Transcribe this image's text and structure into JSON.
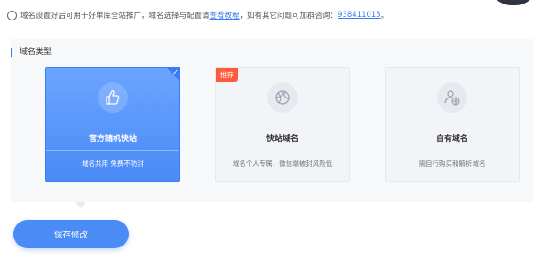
{
  "notice": {
    "icon": "info-icon",
    "text_before": "域名设置好后可用于好单库全站推广，域名选择与配置请",
    "link_text": "查看教程",
    "text_middle": "，如有其它问题可加群咨询：",
    "group_number": "938411015",
    "text_after": "。"
  },
  "section": {
    "title": "域名类型"
  },
  "cards": [
    {
      "title": "官方随机快站",
      "desc": "域名共用 免费不防封",
      "icon": "thumbs-up-icon",
      "selected": true
    },
    {
      "title": "快站域名",
      "desc": "域名个人专属，微信端被封风险低",
      "icon": "ball-icon",
      "badge": "推荐",
      "selected": false
    },
    {
      "title": "自有域名",
      "desc": "需自行购买和解析域名",
      "icon": "user-globe-icon",
      "selected": false
    }
  ],
  "footer": {
    "save_label": "保存修改"
  },
  "colors": {
    "accent": "#4a8bf6",
    "badge": "#ff5a3c",
    "panel": "#f7f8fa"
  }
}
